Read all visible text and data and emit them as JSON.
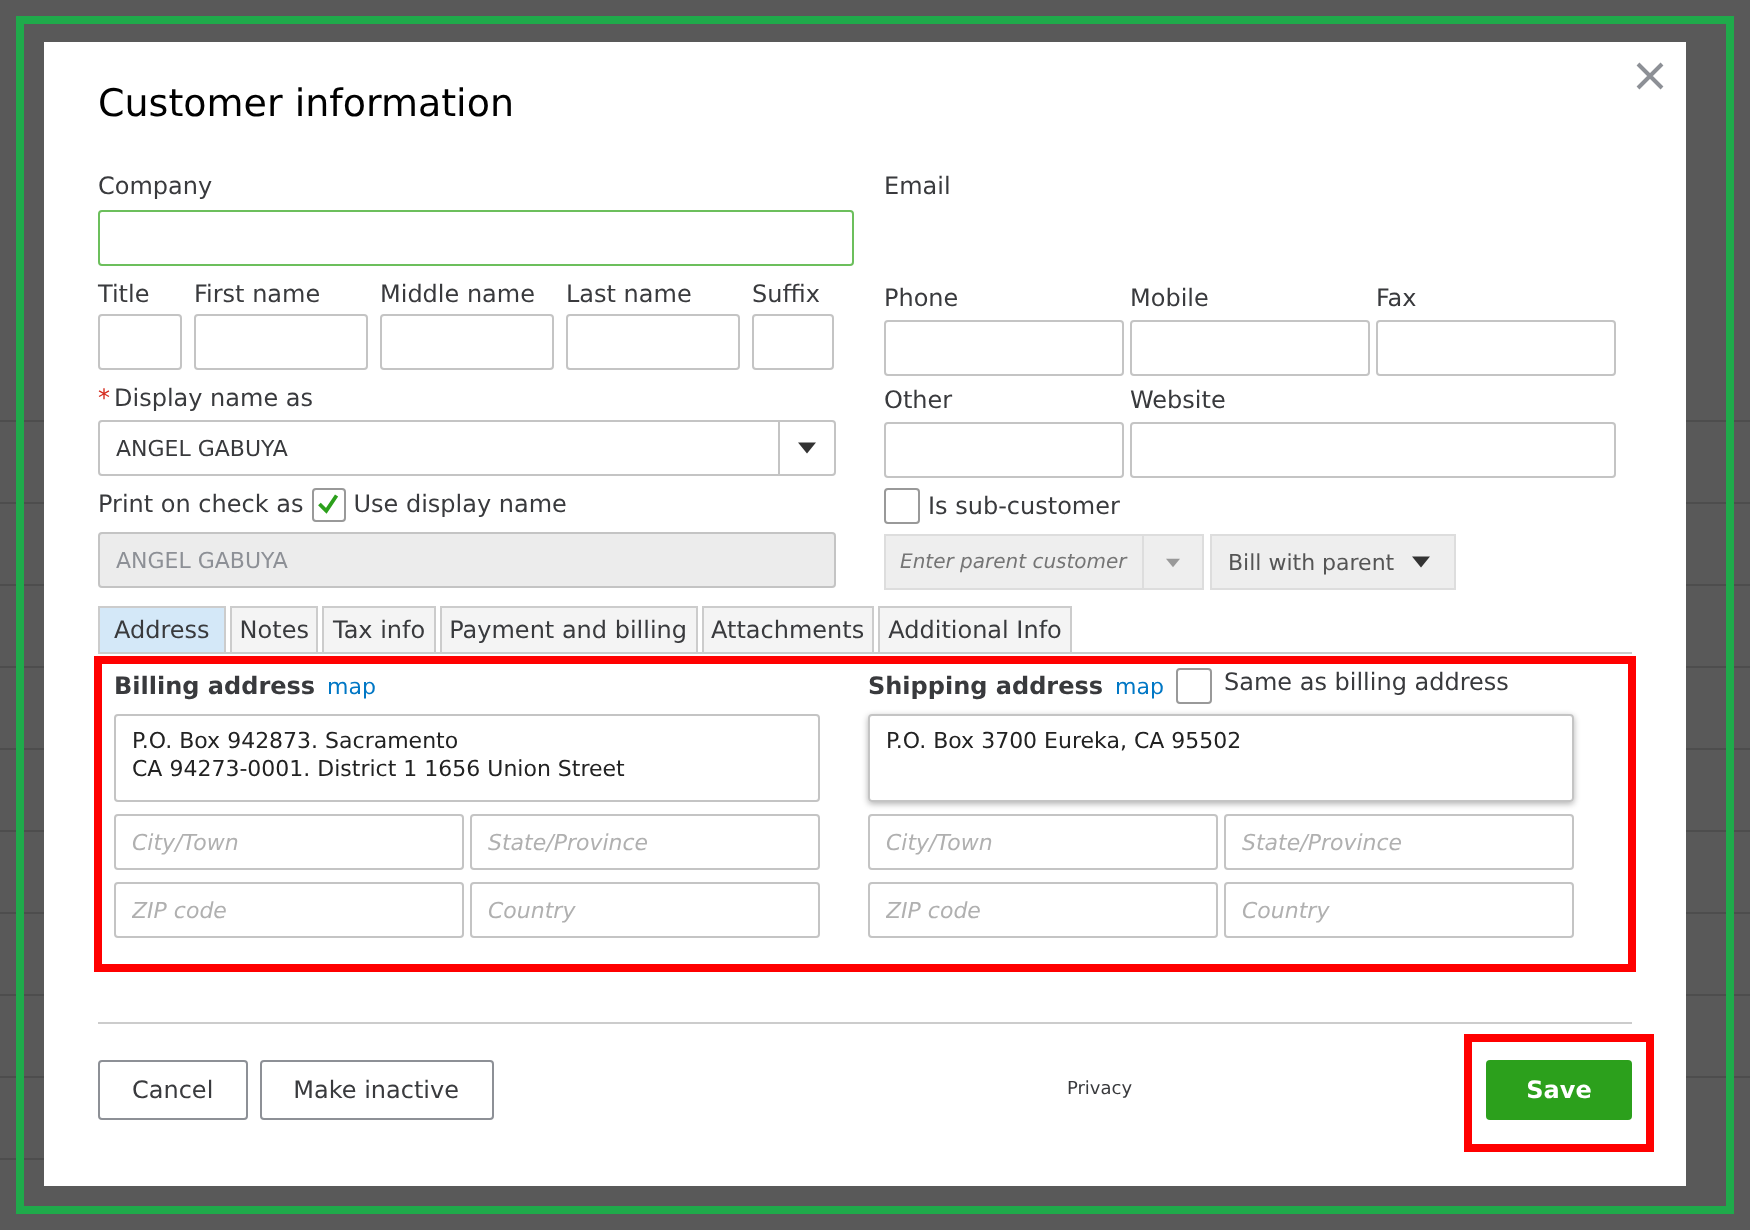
{
  "dialog": {
    "title": "Customer information",
    "company": {
      "label": "Company"
    },
    "name_fields": [
      {
        "label": "Title"
      },
      {
        "label": "First name"
      },
      {
        "label": "Middle name"
      },
      {
        "label": "Last name"
      },
      {
        "label": "Suffix"
      }
    ],
    "display_name": {
      "required_mark": "*",
      "label": "Display name as",
      "value": "ANGEL GABUYA"
    },
    "print_on_check": {
      "label": "Print on check as",
      "checkbox_label": "Use display name",
      "checked": true,
      "value": "ANGEL GABUYA"
    },
    "email": {
      "label": "Email"
    },
    "contact_fields": [
      {
        "label": "Phone"
      },
      {
        "label": "Mobile"
      },
      {
        "label": "Fax"
      }
    ],
    "other_fields": [
      {
        "label": "Other"
      },
      {
        "label": "Website"
      }
    ],
    "sub_customer": {
      "label": "Is sub-customer",
      "checked": false,
      "parent_placeholder": "Enter parent customer",
      "bill_option": "Bill with parent"
    },
    "tabs": [
      {
        "label": "Address",
        "selected": true
      },
      {
        "label": "Notes",
        "selected": false
      },
      {
        "label": "Tax info",
        "selected": false
      },
      {
        "label": "Payment and billing",
        "selected": false
      },
      {
        "label": "Attachments",
        "selected": false
      },
      {
        "label": "Additional Info",
        "selected": false
      }
    ],
    "billing": {
      "label": "Billing address",
      "map_link": "map",
      "street_lines": [
        "P.O. Box 942873. Sacramento",
        "CA 94273-0001. District 1 1656 Union Street"
      ],
      "city_placeholder": "City/Town",
      "state_placeholder": "State/Province",
      "zip_placeholder": "ZIP code",
      "country_placeholder": "Country"
    },
    "shipping": {
      "label": "Shipping address",
      "map_link": "map",
      "same_as_billing": {
        "label": "Same as billing address",
        "checked": false
      },
      "street_lines": [
        "P.O. Box 3700 Eureka, CA 95502"
      ],
      "city_placeholder": "City/Town",
      "state_placeholder": "State/Province",
      "zip_placeholder": "ZIP code",
      "country_placeholder": "Country"
    },
    "buttons": {
      "cancel": "Cancel",
      "make_inactive": "Make inactive",
      "privacy": "Privacy",
      "save": "Save"
    }
  }
}
